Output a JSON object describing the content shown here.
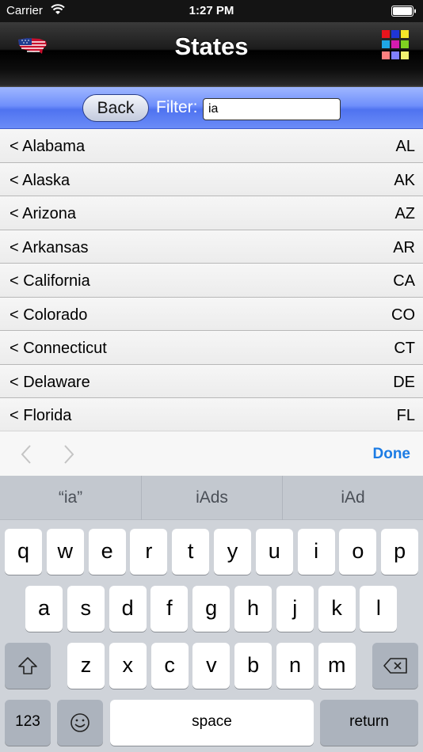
{
  "status_bar": {
    "carrier": "Carrier",
    "time": "1:27 PM"
  },
  "nav_bar": {
    "title": "States",
    "left_icon": "us-flag-icon",
    "right_icon": "color-palette-icon",
    "palette_colors": [
      "#e8141c",
      "#1f36d6",
      "#f5e62a",
      "#1fa6e6",
      "#d61bb0",
      "#7ed321",
      "#ff8080",
      "#8080ff",
      "#f0f070"
    ]
  },
  "filter_bar": {
    "back_label": "Back",
    "filter_label": "Filter:",
    "filter_value": "ia"
  },
  "states": [
    {
      "name": "< Alabama",
      "abbr": "AL"
    },
    {
      "name": "< Alaska",
      "abbr": "AK"
    },
    {
      "name": "< Arizona",
      "abbr": "AZ"
    },
    {
      "name": "< Arkansas",
      "abbr": "AR"
    },
    {
      "name": "< California",
      "abbr": "CA"
    },
    {
      "name": "< Colorado",
      "abbr": "CO"
    },
    {
      "name": "< Connecticut",
      "abbr": "CT"
    },
    {
      "name": "< Delaware",
      "abbr": "DE"
    },
    {
      "name": "< Florida",
      "abbr": "FL"
    }
  ],
  "accessory_bar": {
    "done_label": "Done",
    "accent": "#1c7ce4"
  },
  "keyboard": {
    "suggestions": [
      "“ia”",
      "iAds",
      "iAd"
    ],
    "row1": [
      "q",
      "w",
      "e",
      "r",
      "t",
      "y",
      "u",
      "i",
      "o",
      "p"
    ],
    "row2": [
      "a",
      "s",
      "d",
      "f",
      "g",
      "h",
      "j",
      "k",
      "l"
    ],
    "row3": [
      "z",
      "x",
      "c",
      "v",
      "b",
      "n",
      "m"
    ],
    "numbers_label": "123",
    "space_label": "space",
    "return_label": "return"
  }
}
